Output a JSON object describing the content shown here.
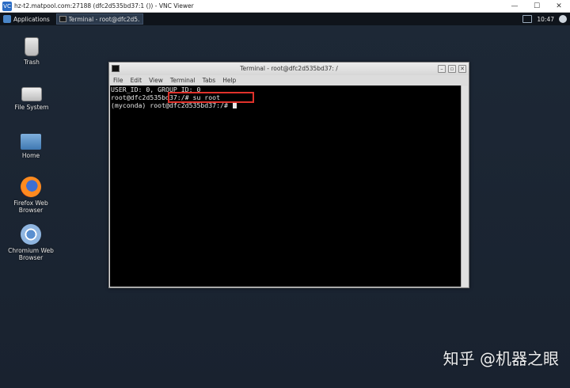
{
  "vnc": {
    "title": "hz-t2.matpool.com:27188 (dfc2d535bd37:1 ()) - VNC Viewer",
    "app_icon": "VC",
    "controls": [
      "—",
      "☐",
      "✕"
    ]
  },
  "panel": {
    "applications_label": "Applications",
    "task_label": "Terminal - root@dfc2d5...",
    "clock": "10:47"
  },
  "desktop_icons": [
    {
      "label": "Trash",
      "icon": "trash-icon"
    },
    {
      "label": "File System",
      "icon": "drive-icon"
    },
    {
      "label": "Home",
      "icon": "home-folder-icon"
    },
    {
      "label": "Firefox Web Browser",
      "icon": "firefox-icon"
    },
    {
      "label": "Chromium Web Browser",
      "icon": "chromium-icon"
    }
  ],
  "terminal": {
    "title": "Terminal - root@dfc2d535bd37: /",
    "menu": [
      "File",
      "Edit",
      "View",
      "Terminal",
      "Tabs",
      "Help"
    ],
    "lines": [
      "USER_ID: 0, GROUP_ID: 0",
      "root@dfc2d535bd37:/# su root",
      "(myconda) root@dfc2d535bd37:/# "
    ],
    "controls": [
      "–",
      "▫",
      "✕"
    ]
  },
  "highlight_color": "#e0322b",
  "watermark": "知乎 @机器之眼"
}
